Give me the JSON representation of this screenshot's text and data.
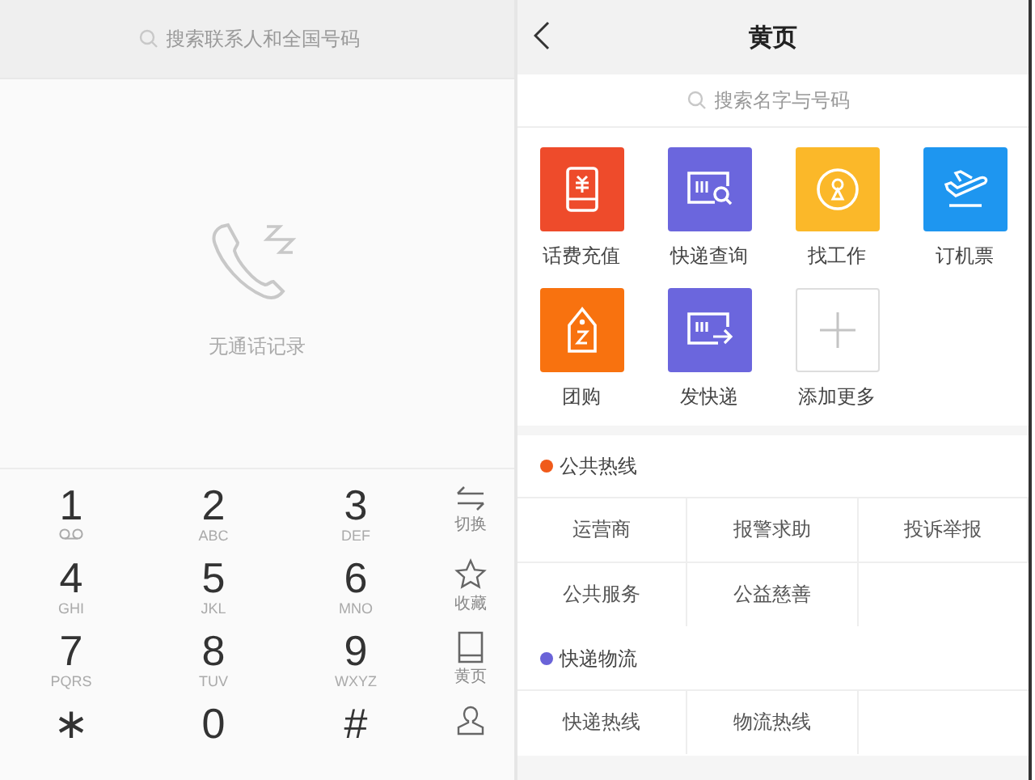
{
  "dialer": {
    "search": {
      "placeholder": "搜索联系人和全国号码"
    },
    "empty_state": {
      "message": "无通话记录"
    },
    "keys": [
      {
        "digit": "1",
        "kind": "voicemail"
      },
      {
        "digit": "2",
        "kind": "letters",
        "letters": "ABC"
      },
      {
        "digit": "3",
        "kind": "letters",
        "letters": "DEF"
      },
      {
        "digit": "4",
        "kind": "letters",
        "letters": "GHI"
      },
      {
        "digit": "5",
        "kind": "letters",
        "letters": "JKL"
      },
      {
        "digit": "6",
        "kind": "letters",
        "letters": "MNO"
      },
      {
        "digit": "7",
        "kind": "letters",
        "letters": "PQRS"
      },
      {
        "digit": "8",
        "kind": "letters",
        "letters": "TUV"
      },
      {
        "digit": "9",
        "kind": "letters",
        "letters": "WXYZ"
      },
      {
        "digit": "∗",
        "kind": "plain"
      },
      {
        "digit": "0",
        "kind": "plain"
      },
      {
        "digit": "#",
        "kind": "plain"
      }
    ],
    "side_actions": [
      {
        "kind": "switch",
        "label": "切换"
      },
      {
        "kind": "star",
        "label": "收藏"
      },
      {
        "kind": "book",
        "label": "黄页"
      },
      {
        "kind": "contact"
      }
    ]
  },
  "yellow_pages": {
    "title": "黄页",
    "search": {
      "placeholder": "搜索名字与号码"
    },
    "shortcuts": [
      {
        "kind": "recharge",
        "label": "话费充值",
        "color": "#ee4b2b"
      },
      {
        "kind": "track",
        "label": "快递查询",
        "color": "#6b66dd"
      },
      {
        "kind": "job",
        "label": "找工作",
        "color": "#fbb829"
      },
      {
        "kind": "flight",
        "label": "订机票",
        "color": "#1e96f0"
      },
      {
        "kind": "group",
        "label": "团购",
        "color": "#f8720f"
      },
      {
        "kind": "send",
        "label": "发快递",
        "color": "#6b66dd"
      },
      {
        "kind": "add",
        "label": "添加更多"
      }
    ],
    "sections": [
      {
        "title": "公共热线",
        "color": "#f05a1a",
        "items": [
          "运营商",
          "报警求助",
          "投诉举报",
          "公共服务",
          "公益慈善"
        ]
      },
      {
        "title": "快递物流",
        "color": "#6a63d8",
        "items": [
          "快递热线",
          "物流热线"
        ]
      }
    ]
  }
}
